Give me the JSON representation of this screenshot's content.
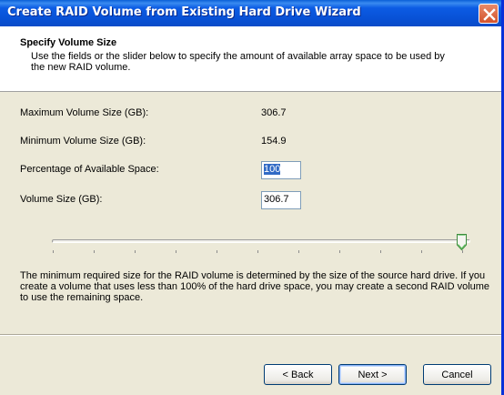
{
  "window": {
    "title": "Create RAID Volume from Existing Hard Drive Wizard"
  },
  "header": {
    "title": "Specify Volume Size",
    "description": "Use the fields or the slider below to specify the amount of available array space to be used by the new RAID volume."
  },
  "fields": {
    "max_label": "Maximum Volume Size (GB):",
    "max_value": "306.7",
    "min_label": "Minimum Volume Size (GB):",
    "min_value": "154.9",
    "percent_label": "Percentage of Available Space:",
    "percent_value": "100",
    "size_label": "Volume Size (GB):",
    "size_value": "306.7"
  },
  "slider": {
    "percent": 100
  },
  "info": "The minimum required size for the RAID volume is determined by the size of the source hard drive. If you create a volume that uses less than 100% of the hard drive space, you may create a second RAID volume to use the remaining space.",
  "buttons": {
    "back": "< Back",
    "next": "Next >",
    "cancel": "Cancel"
  },
  "colors": {
    "titlebar": "#0a5fd8",
    "dialog_bg": "#ece9d8",
    "selection": "#316ac5"
  },
  "icons": {
    "close": "close-icon",
    "slider_thumb": "slider-thumb-icon"
  }
}
